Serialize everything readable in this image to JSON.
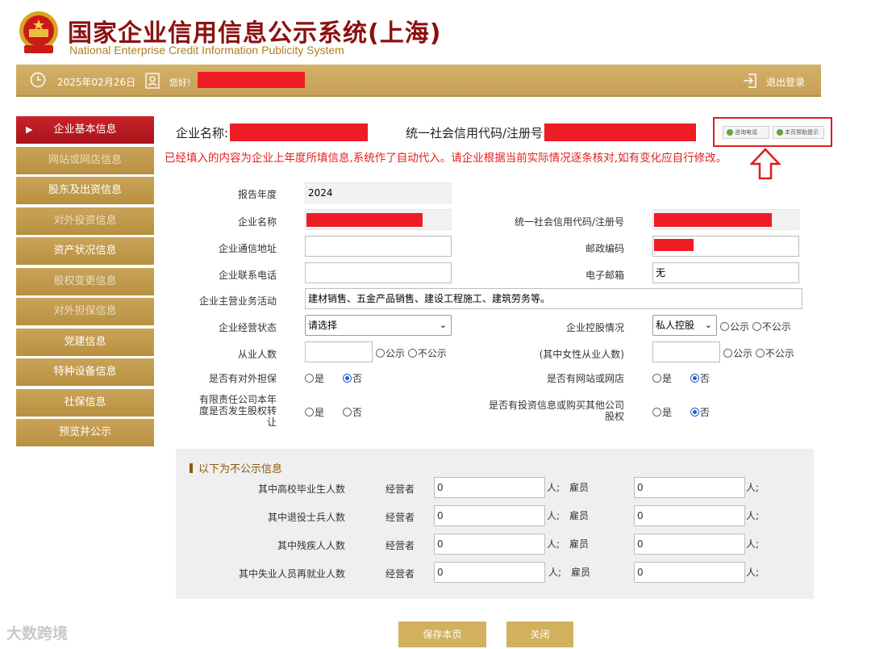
{
  "header": {
    "title": "国家企业信用信息公示系统(上海)",
    "subtitle": "National Enterprise Credit Information Publicity System"
  },
  "topbar": {
    "date": "2025年02月26日",
    "greeting": "您好!",
    "logout": "退出登录"
  },
  "sidebar": {
    "items": [
      {
        "label": "企业基本信息",
        "state": "active"
      },
      {
        "label": "网站或网店信息",
        "state": "muted"
      },
      {
        "label": "股东及出资信息",
        "state": "normal"
      },
      {
        "label": "对外投资信息",
        "state": "muted"
      },
      {
        "label": "资产状况信息",
        "state": "normal"
      },
      {
        "label": "股权变更信息",
        "state": "muted"
      },
      {
        "label": "对外担保信息",
        "state": "muted"
      },
      {
        "label": "党建信息",
        "state": "normal"
      },
      {
        "label": "特种设备信息",
        "state": "normal"
      },
      {
        "label": "社保信息",
        "state": "normal"
      },
      {
        "label": "预览并公示",
        "state": "normal"
      }
    ]
  },
  "info": {
    "company_label": "企业名称:",
    "code_label": "统一社会信用代码/注册号:",
    "notice": "已经填入的内容为企业上年度所填信息,系统作了自动代入。请企业根据当前实际情况逐条核对,如有变化应自行修改。",
    "help_btn1": "咨询电话",
    "help_btn2": "本页帮助提示"
  },
  "form": {
    "report_year_label": "报告年度",
    "report_year_value": "2024",
    "company_name_label": "企业名称",
    "credit_code_label": "统一社会信用代码/注册号",
    "address_label": "企业通信地址",
    "postcode_label": "邮政编码",
    "phone_label": "企业联系电话",
    "email_label": "电子邮箱",
    "email_value": "无",
    "business_label": "企业主营业务活动",
    "business_value": "建材销售、五金产品销售、建设工程施工、建筑劳务等。",
    "status_label": "企业经营状态",
    "status_value": "请选择",
    "holding_label": "企业控股情况",
    "holding_value": "私人控股",
    "public": "公示",
    "not_public": "不公示",
    "employees_label": "从业人数",
    "female_label": "(其中女性从业人数)",
    "guarantee_label": "是否有对外担保",
    "website_label": "是否有网站或网店",
    "equity_transfer_label": "有限责任公司本年度是否发生股权转让",
    "invest_label": "是否有投资信息或购买其他公司股权",
    "yes": "是",
    "no": "否"
  },
  "nonpublic": {
    "title": "以下为不公示信息",
    "operator": "经营者",
    "employee": "雇员",
    "unit1": "人;",
    "rows": [
      {
        "label": "其中高校毕业生人数",
        "operator_value": "0",
        "employee_value": "0"
      },
      {
        "label": "其中退役士兵人数",
        "operator_value": "0",
        "employee_value": "0"
      },
      {
        "label": "其中残疾人人数",
        "operator_value": "0",
        "employee_value": "0"
      },
      {
        "label": "其中失业人员再就业人数",
        "operator_value": "0",
        "employee_value": "0"
      }
    ]
  },
  "buttons": {
    "save": "保存本页",
    "close": "关闭"
  },
  "watermark": "大数跨境",
  "colors": {
    "accent_gold": "#c6a056",
    "active_red": "#b8141c",
    "notice_red": "#e02020",
    "redaction": "#ee1c24"
  }
}
